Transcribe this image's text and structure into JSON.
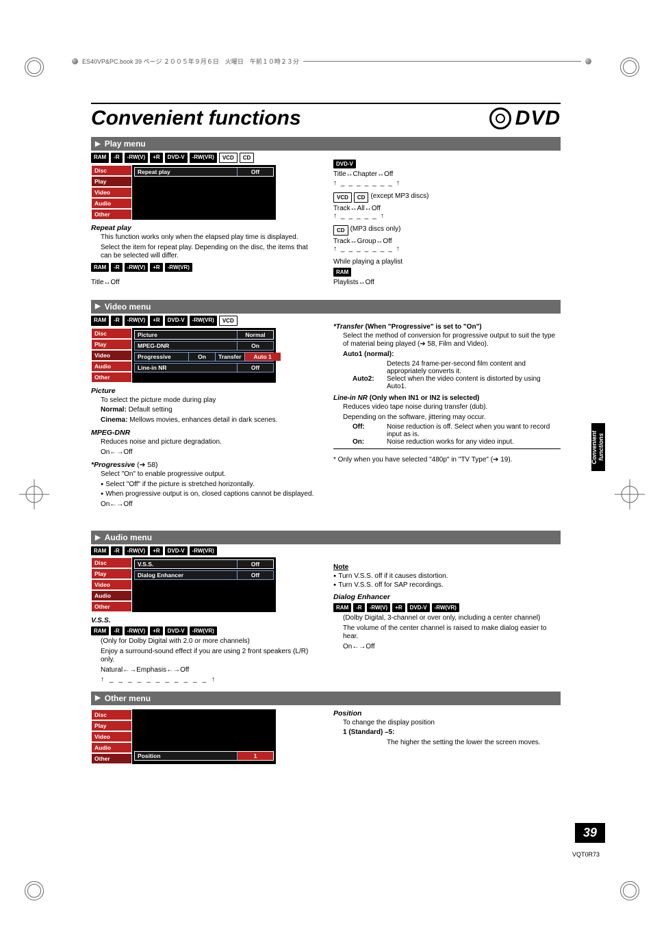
{
  "printer_header": "ES40VP&PC.book  39 ページ  ２００５年９月６日　火曜日　午前１０時２３分",
  "title": "Convenient functions",
  "dvd_logo_text": "DVD",
  "side_tab": "Convenient functions",
  "page_number": "39",
  "doc_code": "VQT0R73",
  "sections": {
    "play": {
      "bar": "Play menu",
      "badges": [
        "RAM",
        "-R",
        "-RW(V)",
        "+R",
        "DVD-V",
        "-RW(VR)",
        "VCD",
        "CD"
      ],
      "osd_tabs": [
        "Disc",
        "Play",
        "Video",
        "Audio",
        "Other"
      ],
      "osd_row_label": "Repeat play",
      "osd_row_value": "Off",
      "repeat": {
        "h": "Repeat play",
        "p1": "This function works only when the elapsed play time is displayed.",
        "p2": "Select the item for repeat play. Depending on the disc, the items that can be selected will differ.",
        "badges2": [
          "RAM",
          "-R",
          "-RW(V)",
          "+R",
          "-RW(VR)"
        ],
        "line1": "Title↔Off"
      },
      "right": {
        "dvdv_badge": "DVD-V",
        "dvdv_line": "Title↔Chapter↔Off",
        "vcd_cd": [
          "VCD",
          "CD"
        ],
        "vcd_cd_note": "(except MP3 discs)",
        "vcd_cd_line": "Track↔All↔Off",
        "cd_only": "CD",
        "cd_only_note": "(MP3 discs only)",
        "cd_only_line": "Track↔Group↔Off",
        "playlist_h": "While playing a playlist",
        "playlist_badge": "RAM",
        "playlist_line": "Playlists↔Off"
      }
    },
    "video": {
      "bar": "Video menu",
      "badges": [
        "RAM",
        "-R",
        "-RW(V)",
        "+R",
        "DVD-V",
        "-RW(VR)",
        "VCD"
      ],
      "osd_tabs": [
        "Disc",
        "Play",
        "Video",
        "Audio",
        "Other"
      ],
      "rows": [
        {
          "label": "Picture",
          "value": "Normal",
          "ol": true
        },
        {
          "label": "MPEG-DNR",
          "value": "On"
        },
        {
          "label": "Progressive",
          "mids": [
            "On",
            "Transfer"
          ],
          "value": "Auto 1",
          "red": true
        },
        {
          "label": "Line-in NR",
          "value": "Off"
        }
      ],
      "picture": {
        "h": "Picture",
        "p": "To select the picture mode during play",
        "normal": "Normal:",
        "normal_t": "Default setting",
        "cinema": "Cinema:",
        "cinema_t": "Mellows movies, enhances detail in dark scenes."
      },
      "mpeg": {
        "h": "MPEG-DNR",
        "p": "Reduces noise and picture degradation.",
        "line": "On←→Off"
      },
      "prog": {
        "h": "*Progressive",
        "ref": "(➔ 58)",
        "p1": "Select \"On\" to enable progressive output.",
        "b1": "Select \"Off\" if the picture is stretched horizontally.",
        "b2": "When progressive output is on, closed captions cannot be displayed.",
        "line": "On←→Off"
      },
      "transfer": {
        "h": "*Transfer",
        "note": "(When \"Progressive\" is set to \"On\")",
        "p": "Select the method of conversion for progressive output to suit the type of material being played (➔ 58, Film and Video).",
        "a1": "Auto1 (normal):",
        "a1t": "Detects 24 frame-per-second film content and appropriately converts it.",
        "a2": "Auto2:",
        "a2t": "Select when the video content is distorted by using Auto1."
      },
      "linein": {
        "h": "Line-in NR",
        "note": "(Only when IN1 or IN2 is selected)",
        "p1": "Reduces video tape noise during transfer (dub).",
        "p2": "Depending on the software, jittering may occur.",
        "off": "Off:",
        "off_t": "Noise reduction is off. Select when you want to record input as is.",
        "on": "On:",
        "on_t": "Noise reduction works for any video input."
      },
      "footnote": "* Only when you have selected \"480p\" in \"TV Type\" (➔ 19)."
    },
    "audio": {
      "bar": "Audio menu",
      "badges": [
        "RAM",
        "-R",
        "-RW(V)",
        "+R",
        "DVD-V",
        "-RW(VR)"
      ],
      "osd_tabs": [
        "Disc",
        "Play",
        "Video",
        "Audio",
        "Other"
      ],
      "rows": [
        {
          "label": "V.S.S.",
          "value": "Off"
        },
        {
          "label": "Dialog Enhancer",
          "value": "Off"
        }
      ],
      "vss": {
        "h": "V.S.S.",
        "badges": [
          "RAM",
          "-R",
          "-RW(V)",
          "+R",
          "DVD-V",
          "-RW(VR)"
        ],
        "p1": "(Only for Dolby Digital with 2.0 or more channels)",
        "p2": "Enjoy a surround-sound effect if you are using 2 front speakers (L/R) only.",
        "line": "Natural←→Emphasis←→Off"
      },
      "right": {
        "note_h": "Note",
        "n1": "Turn V.S.S. off if it causes distortion.",
        "n2": "Turn V.S.S. off for SAP recordings.",
        "de_h": "Dialog Enhancer",
        "de_badges": [
          "RAM",
          "-R",
          "-RW(V)",
          "+R",
          "DVD-V",
          "-RW(VR)"
        ],
        "de_p1": "(Dolby Digital, 3-channel or over only, including a center channel)",
        "de_p2": "The volume of the center channel is raised to make dialog easier to hear.",
        "de_line": "On←→Off"
      }
    },
    "other": {
      "bar": "Other menu",
      "osd_tabs": [
        "Disc",
        "Play",
        "Video",
        "Audio",
        "Other"
      ],
      "row_label": "Position",
      "row_value": "1",
      "pos": {
        "h": "Position",
        "p": "To change the display position",
        "std": "1 (Standard) –5:",
        "std_t": "The higher the setting the lower the screen moves."
      }
    }
  }
}
